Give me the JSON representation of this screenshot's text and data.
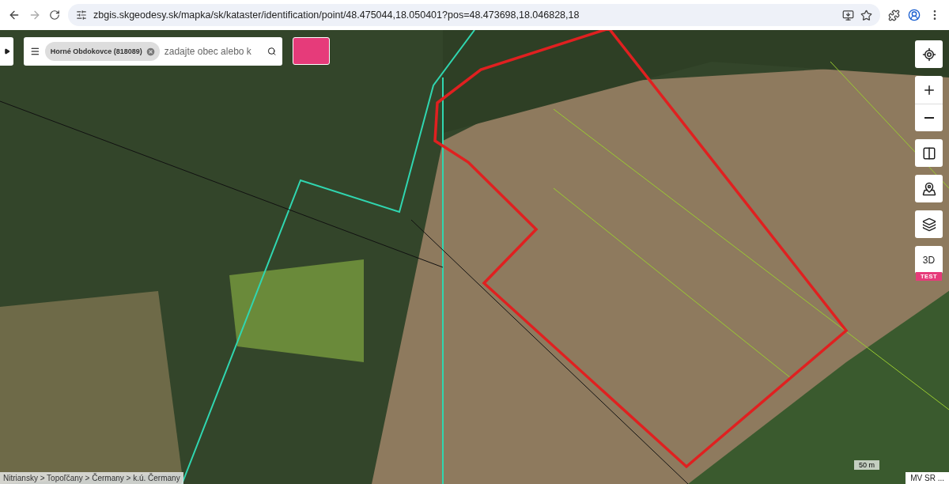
{
  "browser": {
    "url": "zbgis.skgeodesy.sk/mapka/sk/kataster/identification/point/48.475044,18.050401?pos=48.473698,18.046828,18"
  },
  "search": {
    "chip": "Horné Obdokovce (818089)",
    "placeholder": "zadajte obec alebo k"
  },
  "map_controls": [
    {
      "kind": "locate"
    },
    {
      "kind": "zoom_in"
    },
    {
      "kind": "zoom_out"
    },
    {
      "kind": "compare"
    },
    {
      "kind": "basemap"
    },
    {
      "kind": "layers"
    },
    {
      "kind": "threed",
      "label": "3D",
      "badge": "TEST"
    }
  ],
  "breadcrumb": "Nitriansky > Topoľčany > Čermany > k.ú. Čermany",
  "scale": "50 m",
  "attribution": "MV SR ..."
}
